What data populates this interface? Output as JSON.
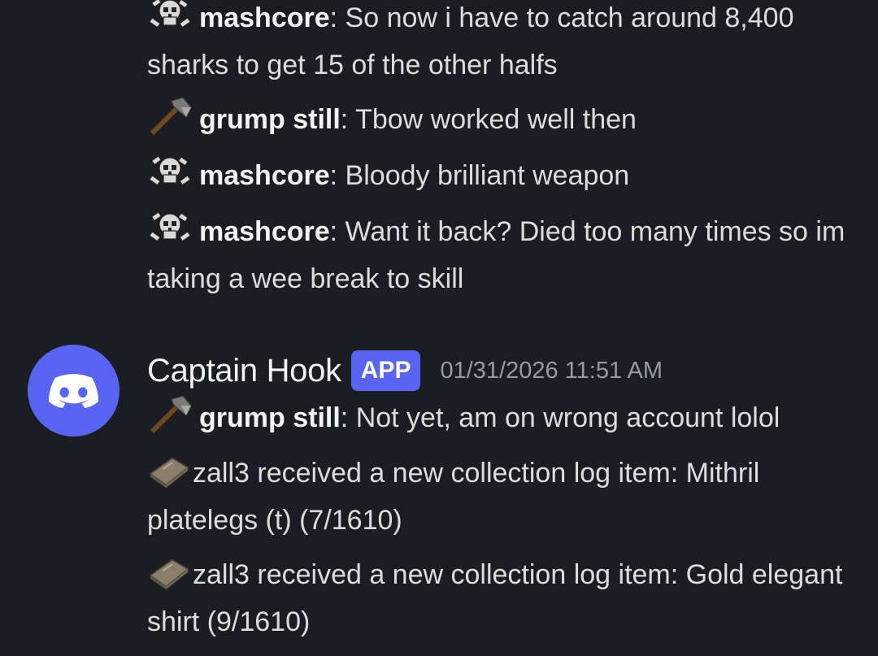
{
  "messages_top": [
    {
      "icon": "skull-crossbones-icon",
      "user": "mashcore",
      "text": "So now i have to catch around 8,400 sharks to get 15 of the other halfs"
    },
    {
      "icon": "axe-icon",
      "user": "grump still",
      "text": "Tbow worked well then"
    },
    {
      "icon": "skull-crossbones-icon",
      "user": "mashcore",
      "text": "Bloody brilliant weapon"
    },
    {
      "icon": "skull-crossbones-icon",
      "user": "mashcore",
      "text": "Want it back? Died too many times so im taking a wee break to skill"
    }
  ],
  "group": {
    "author": "Captain Hook",
    "badge": "APP",
    "timestamp": "01/31/2026 11:51 AM",
    "avatar_icon": "discord-logo-icon",
    "avatar_color": "#5865f2"
  },
  "messages_bottom": [
    {
      "icon": "axe-icon",
      "user": "grump still",
      "text": "Not yet, am on wrong account lolol"
    },
    {
      "icon": "book-icon",
      "text": "zall3 received a new collection log item: Mithril platelegs (t) (7/1610)"
    },
    {
      "icon": "book-icon",
      "text": "zall3 received a new collection log item: Gold elegant shirt (9/1610)"
    }
  ],
  "colors": {
    "background": "#1c1d22",
    "text": "#dbdee1",
    "username": "#f2f3f5",
    "timestamp": "#949ba4",
    "brand": "#5865f2"
  },
  "separator": ":"
}
